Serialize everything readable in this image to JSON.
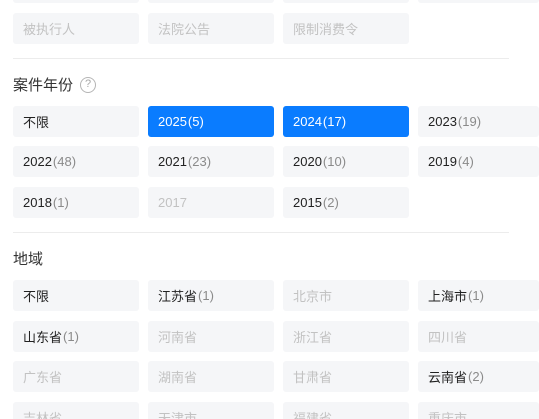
{
  "top_filters": [
    "被执行人",
    "法院公告",
    "限制消费令"
  ],
  "year_section": {
    "title": "案件年份",
    "help_icon": "question-circle-icon",
    "options": [
      {
        "label": "不限",
        "count": ""
      },
      {
        "label": "2025",
        "count": "(5)"
      },
      {
        "label": "2024",
        "count": "(17)"
      },
      {
        "label": "2023",
        "count": "(19)"
      },
      {
        "label": "2022",
        "count": "(48)"
      },
      {
        "label": "2021",
        "count": "(23)"
      },
      {
        "label": "2020",
        "count": "(10)"
      },
      {
        "label": "2019",
        "count": "(4)"
      },
      {
        "label": "2018",
        "count": "(1)"
      },
      {
        "label": "2017",
        "count": ""
      },
      {
        "label": "2015",
        "count": "(2)"
      }
    ],
    "selected": [
      "2025",
      "2024"
    ]
  },
  "region_section": {
    "title": "地域",
    "options": [
      {
        "label": "不限",
        "count": ""
      },
      {
        "label": "江苏省",
        "count": "(1)"
      },
      {
        "label": "北京市",
        "count": ""
      },
      {
        "label": "上海市",
        "count": "(1)"
      },
      {
        "label": "山东省",
        "count": "(1)"
      },
      {
        "label": "河南省",
        "count": ""
      },
      {
        "label": "浙江省",
        "count": ""
      },
      {
        "label": "四川省",
        "count": ""
      },
      {
        "label": "广东省",
        "count": ""
      },
      {
        "label": "湖南省",
        "count": ""
      },
      {
        "label": "甘肃省",
        "count": ""
      },
      {
        "label": "云南省",
        "count": "(2)"
      },
      {
        "label": "吉林省",
        "count": ""
      },
      {
        "label": "天津市",
        "count": ""
      },
      {
        "label": "福建省",
        "count": ""
      },
      {
        "label": "重庆市",
        "count": ""
      }
    ]
  },
  "colors": {
    "accent": "#0a7cff",
    "chip_bg": "#f5f6f8",
    "disabled_text": "#c2c2c2",
    "count_text": "#8a8a8a"
  }
}
